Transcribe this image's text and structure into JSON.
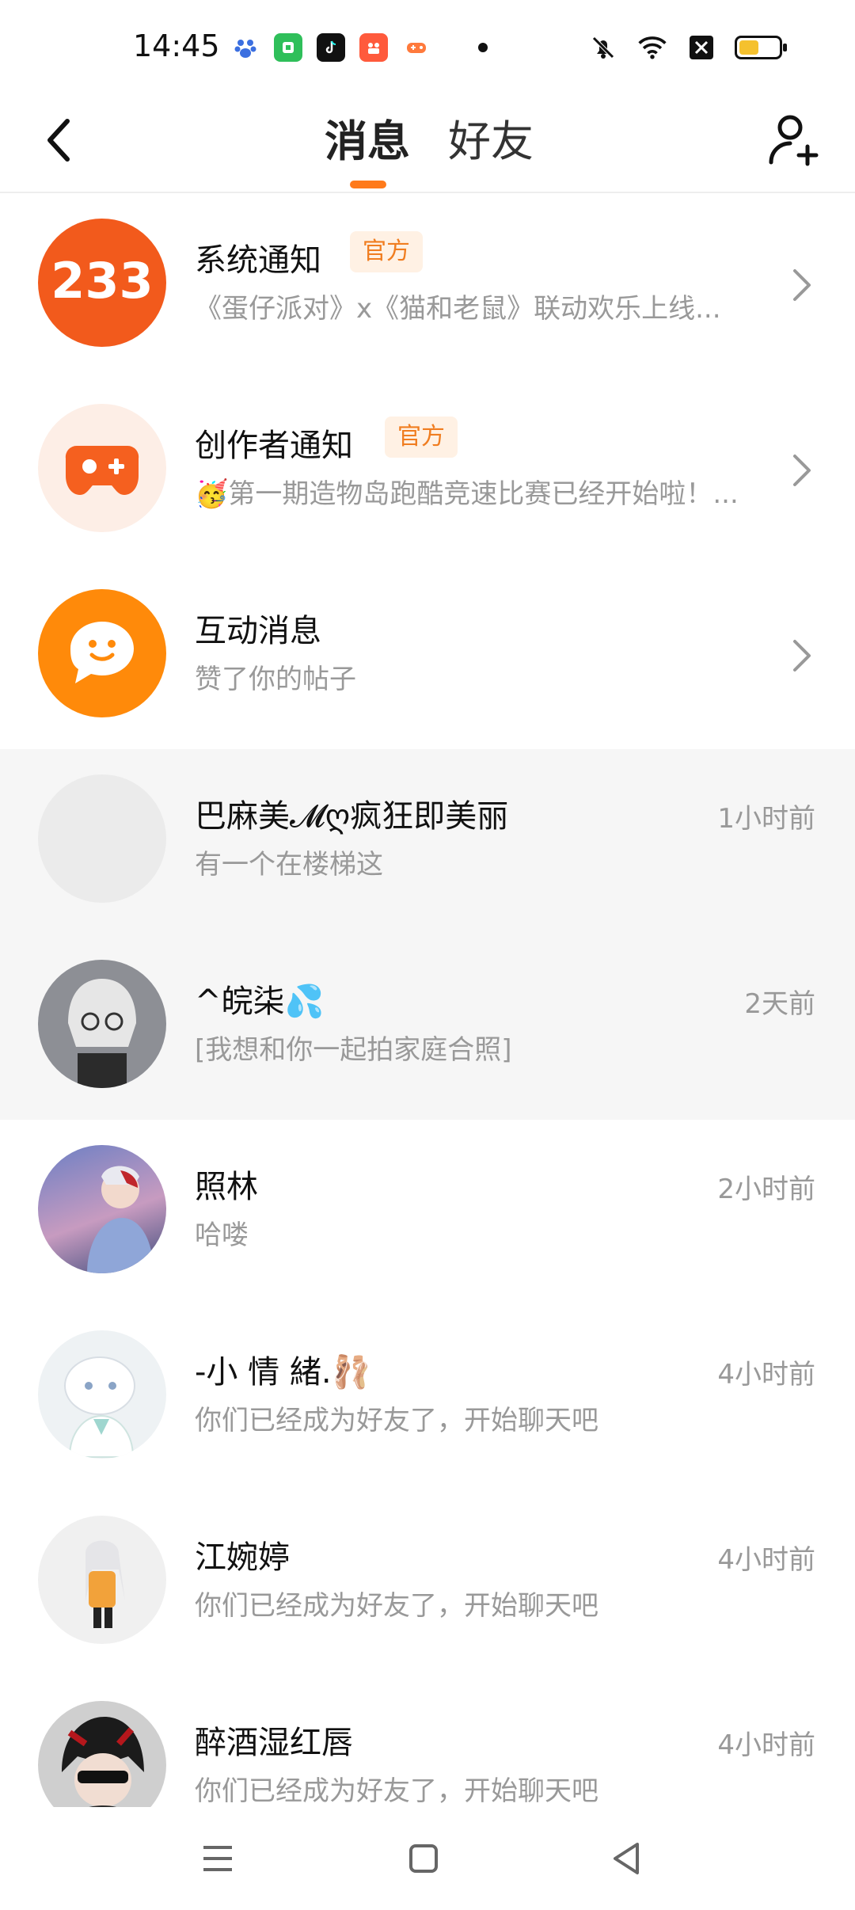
{
  "status_bar": {
    "time": "14:45",
    "apps": [
      {
        "name": "baidu-app-icon",
        "color": "#3b6fe0"
      },
      {
        "name": "green-app-icon",
        "color": "#2fbf5a"
      },
      {
        "name": "tiktok-app-icon",
        "color": "#111111"
      },
      {
        "name": "video-app-icon",
        "color": "#ff5a3c"
      },
      {
        "name": "game-app-icon",
        "color": "#ff7a3c"
      }
    ],
    "battery_level": 0.55,
    "battery_color": "#f5c12e"
  },
  "header": {
    "tab_messages": "消息",
    "tab_friends": "好友",
    "accent_color": "#ff7a1a"
  },
  "official_badge": "官方",
  "items": [
    {
      "title": "系统通知",
      "subtitle": "《蛋仔派对》x《猫和老鼠》联动欢乐上线...",
      "badge": "官方",
      "avatar_text": "233",
      "avatar_icon": "logo-233-icon"
    },
    {
      "title": "创作者通知",
      "subtitle": "🥳第一期造物岛跑酷竞速比赛已经开始啦！...",
      "badge": "官方",
      "avatar_icon": "gamepad-icon"
    },
    {
      "title": "互动消息",
      "subtitle": "赞了你的帖子",
      "avatar_icon": "chat-bubble-icon"
    },
    {
      "title": "巴麻美𝓜ღ疯狂即美丽",
      "subtitle": "有一个在楼梯这",
      "time": "1小时前"
    },
    {
      "title": "^皖柒💦",
      "subtitle": "[我想和你一起拍家庭合照]",
      "time": "2天前"
    },
    {
      "title": "照林",
      "subtitle": "哈喽",
      "time": "2小时前"
    },
    {
      "title": "-小 情 緒.🩰",
      "subtitle": "你们已经成为好友了，开始聊天吧",
      "time": "4小时前"
    },
    {
      "title": "江婉婷",
      "subtitle": "你们已经成为好友了，开始聊天吧",
      "time": "4小时前"
    },
    {
      "title": "醉酒湿红唇",
      "subtitle": "你们已经成为好友了，开始聊天吧",
      "time": "4小时前"
    }
  ]
}
